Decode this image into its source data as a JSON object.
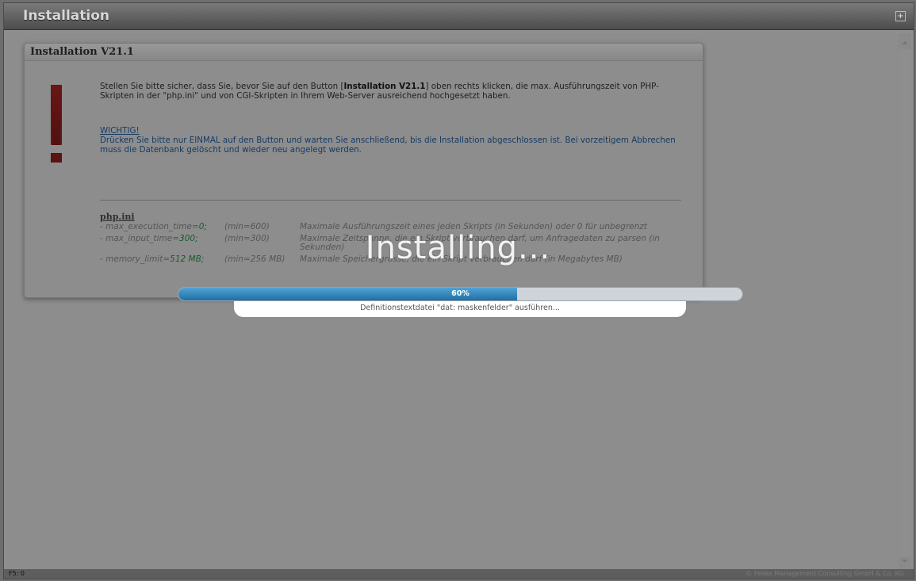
{
  "window": {
    "title": "Installation",
    "maximize_icon": "maximize-icon"
  },
  "panel": {
    "title": "Installation V21.1",
    "intro_part1": "Stellen Sie bitte sicher, dass Sie, bevor Sie auf den Button [",
    "intro_bold": "Installation V21.1",
    "intro_part2": "] oben rechts klicken, die max. Ausführungszeit von PHP-Skripten in der \"php.ini\" und von CGI-Skripten in Ihrem Web-Server ausreichend hochgesetzt haben.",
    "wichtig_link": "WICHTIG!",
    "wichtig_text": "Drücken Sie bitte nur EINMAL auf den Button und warten Sie anschließend, bis die Installation abgeschlossen ist. Bei vorzeitigem Abbrechen muss die Datenbank gelöscht und wieder neu angelegt werden.",
    "phpini_head": "php.ini",
    "rows": [
      {
        "key": "- max_execution_time=",
        "val": "0;",
        "min": "(min=600)",
        "desc": "Maximale Ausführungszeit eines jeden Skripts (in Sekunden) oder 0 für unbegrenzt"
      },
      {
        "key": "- max_input_time=",
        "val": "300;",
        "min": "(min=300)",
        "desc": "Maximale Zeitspanne, die ein Skript verbrauchen darf, um Anfragedaten zu parsen (in Sekunden)"
      },
      {
        "key": "- memory_limit=",
        "val": "512 MB;",
        "min": "(min=256 MB)",
        "desc": "Maximale Speichergrösse, die ein Skript verbrauchen darf (in Megabytes MB)"
      }
    ]
  },
  "overlay": {
    "title": "Installing...",
    "progress_label": "60%",
    "progress_value": 60,
    "status": "Definitionstextdatei \"dat: maskenfelder\" ausführen..."
  },
  "footer": {
    "left": "F5: 0",
    "right": "© Fellex Management Consulting GmbH & Co. KG"
  }
}
